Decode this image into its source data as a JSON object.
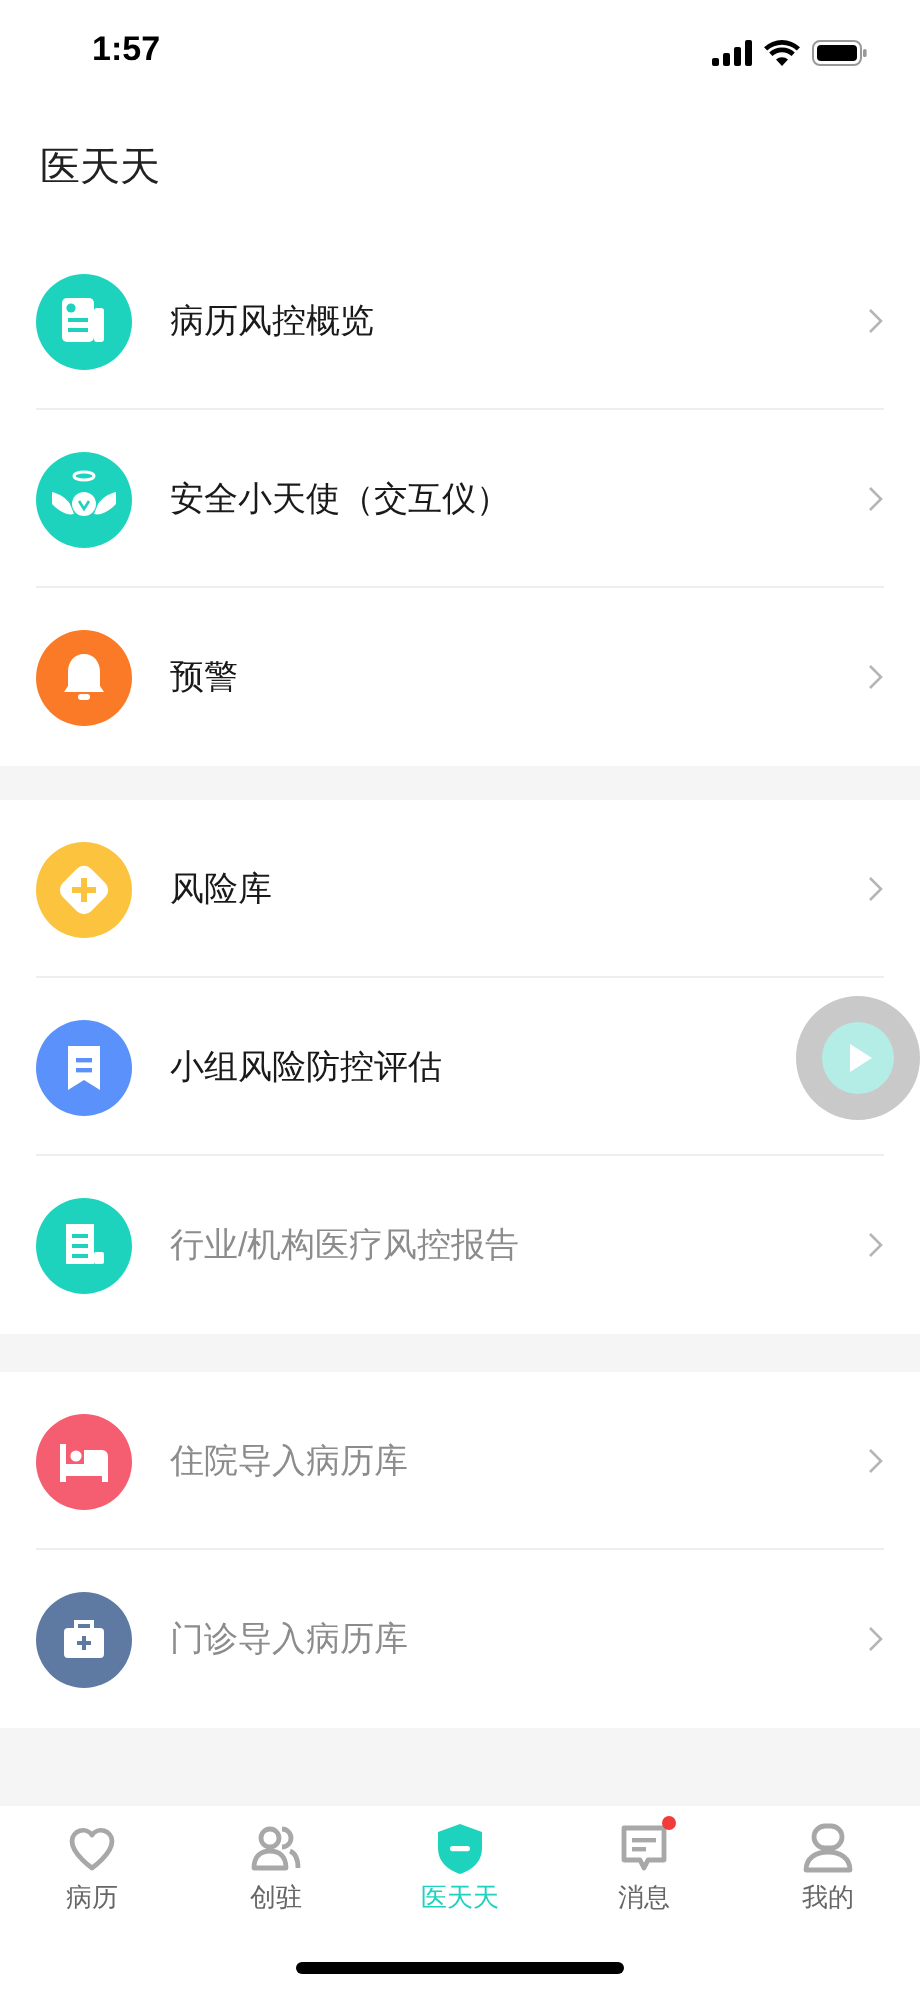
{
  "status_bar": {
    "time": "1:57"
  },
  "title": "医天天",
  "groups": [
    {
      "items": [
        {
          "label": "病历风控概览",
          "kind": "document",
          "color": "#1ed3bd",
          "disabled": false,
          "chevron": true
        },
        {
          "label": "安全小天使（交互仪）",
          "kind": "angel",
          "color": "#1ed3bd",
          "disabled": false,
          "chevron": true
        },
        {
          "label": "预警",
          "kind": "bell",
          "color": "#fb7a27",
          "disabled": false,
          "chevron": true
        }
      ]
    },
    {
      "items": [
        {
          "label": "风险库",
          "kind": "plus",
          "color": "#fcc43e",
          "disabled": false,
          "chevron": true
        },
        {
          "label": "小组风险防控评估",
          "kind": "bookmark",
          "color": "#5b91fa",
          "disabled": false,
          "chevron": false
        },
        {
          "label": "行业/机构医疗风控报告",
          "kind": "scroll",
          "color": "#1ed3bd",
          "disabled": true,
          "chevron": true
        }
      ]
    },
    {
      "items": [
        {
          "label": "住院导入病历库",
          "kind": "bed",
          "color": "#f55d71",
          "disabled": true,
          "chevron": true
        },
        {
          "label": "门诊导入病历库",
          "kind": "kit",
          "color": "#5e7aa3",
          "disabled": true,
          "chevron": true
        }
      ]
    }
  ],
  "floating_button": {
    "kind": "play"
  },
  "tabs": [
    {
      "label": "病历",
      "kind": "heart",
      "selected": false,
      "badge": false
    },
    {
      "label": "创驻",
      "kind": "people",
      "selected": false,
      "badge": false
    },
    {
      "label": "医天天",
      "kind": "shield",
      "selected": true,
      "badge": false
    },
    {
      "label": "消息",
      "kind": "message",
      "selected": false,
      "badge": true
    },
    {
      "label": "我的",
      "kind": "person",
      "selected": false,
      "badge": false
    }
  ]
}
